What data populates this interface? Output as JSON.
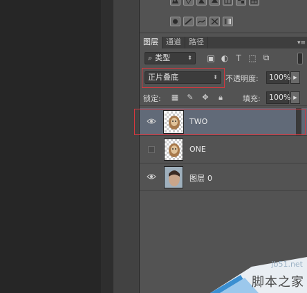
{
  "tabs": [
    {
      "label": "图层",
      "active": true
    },
    {
      "label": "通道",
      "active": false
    },
    {
      "label": "路径",
      "active": false
    }
  ],
  "tab_menu_icon": "panel-menu-icon",
  "filter": {
    "value": "类型",
    "icons": [
      "image-filter-icon",
      "adjustment-filter-icon",
      "type-filter-icon",
      "shape-filter-icon",
      "smart-object-filter-icon"
    ]
  },
  "blend": {
    "mode": "正片叠底",
    "opacity_label": "不透明度:",
    "opacity": "100%"
  },
  "lock": {
    "label": "锁定:",
    "icons": [
      "lock-transparent-icon",
      "lock-image-icon",
      "lock-position-icon",
      "lock-all-icon"
    ],
    "fill_label": "填充:",
    "fill": "100%"
  },
  "layers": [
    {
      "name": "TWO",
      "suffix": "",
      "visible": true,
      "selected": true
    },
    {
      "name": "ONE",
      "suffix": "",
      "visible": false,
      "selected": false
    },
    {
      "name": "图层",
      "suffix": "0",
      "visible": true,
      "selected": false
    }
  ],
  "watermark": {
    "site": "jb51.net",
    "brand": "脚本之家"
  },
  "colors": {
    "panel": "#535353",
    "selected_layer": "#616a78",
    "highlight": "#d4383f",
    "background": "#262626"
  }
}
